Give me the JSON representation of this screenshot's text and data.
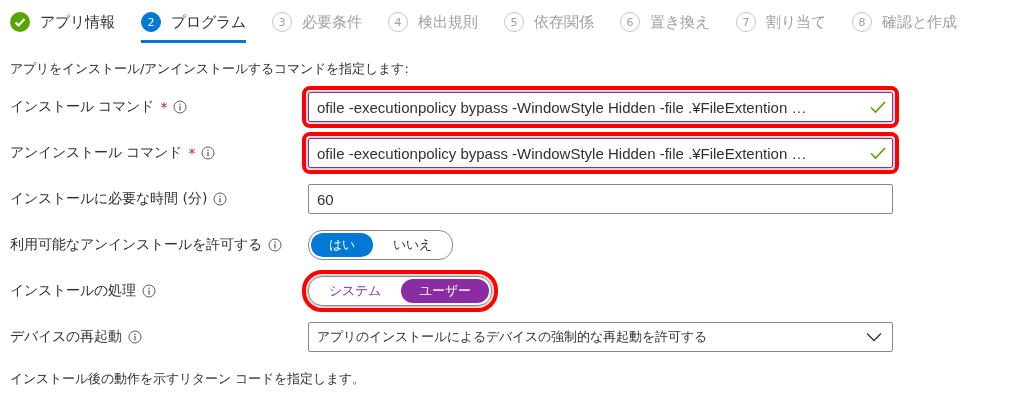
{
  "steps": [
    {
      "label": "アプリ情報",
      "done": true,
      "selected": false
    },
    {
      "number": "2",
      "label": "プログラム",
      "done": false,
      "selected": true
    },
    {
      "number": "3",
      "label": "必要条件",
      "done": false,
      "selected": false
    },
    {
      "number": "4",
      "label": "検出規則",
      "done": false,
      "selected": false
    },
    {
      "number": "5",
      "label": "依存関係",
      "done": false,
      "selected": false
    },
    {
      "number": "6",
      "label": "置き換え",
      "done": false,
      "selected": false
    },
    {
      "number": "7",
      "label": "割り当て",
      "done": false,
      "selected": false
    },
    {
      "number": "8",
      "label": "確認と作成",
      "done": false,
      "selected": false
    }
  ],
  "intro": "アプリをインストール/アンインストールするコマンドを指定します:",
  "fields": [
    {
      "kind": "text",
      "label": "インストール コマンド",
      "required_mark": "*",
      "value": "ofile -executionpolicy bypass -WindowStyle Hidden -file .¥FileExtention …",
      "valid": true,
      "highlighted": true
    },
    {
      "kind": "text",
      "label": "アンインストール コマンド",
      "required_mark": "*",
      "value": "ofile -executionpolicy bypass -WindowStyle Hidden -file .¥FileExtention …",
      "valid": true,
      "highlighted": true
    },
    {
      "kind": "text",
      "label": "インストールに必要な時間 (分)",
      "value": "60",
      "valid": false,
      "highlighted": false
    },
    {
      "kind": "toggle",
      "label": "利用可能なアンインストールを許可する",
      "highlighted": false,
      "options": [
        {
          "label": "はい",
          "selected": true
        },
        {
          "label": "いいえ",
          "selected": false
        }
      ]
    },
    {
      "kind": "toggle",
      "label": "インストールの処理",
      "highlighted": true,
      "options": [
        {
          "label": "システム",
          "selected": false
        },
        {
          "label": "ユーザー",
          "selected": true
        }
      ]
    },
    {
      "kind": "select",
      "label": "デバイスの再起動",
      "value": "アプリのインストールによるデバイスの強制的な再起動を許可する",
      "highlighted": false
    }
  ],
  "footer": "インストール後の動作を示すリターン コードを指定します。"
}
